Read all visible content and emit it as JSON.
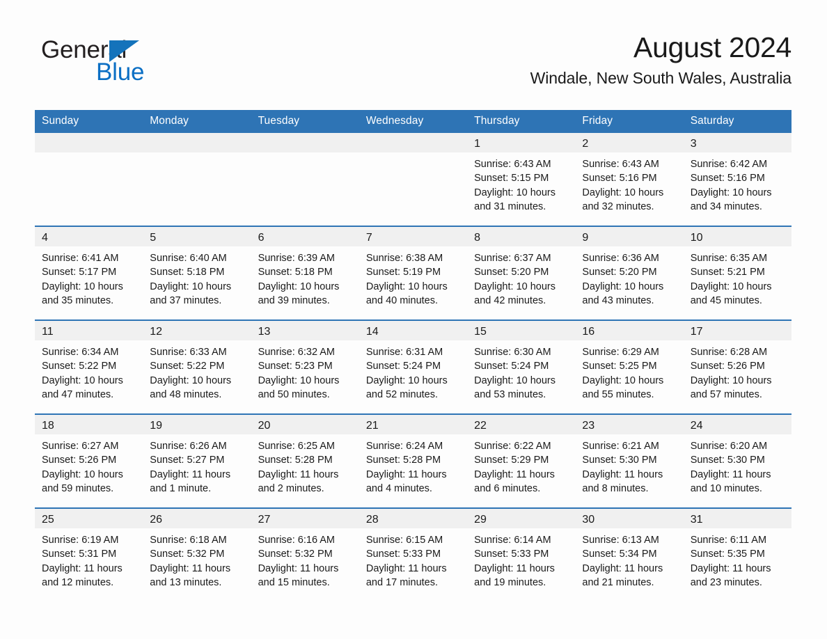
{
  "brand": {
    "name_part1": "General",
    "name_part2": "Blue",
    "accent_color": "#1473bb",
    "blue_text_color": "#0b6fc4",
    "triangle_icon": "triangle-icon"
  },
  "header": {
    "month_title": "August 2024",
    "location": "Windale, New South Wales, Australia"
  },
  "colors": {
    "header_bar": "#2e74b5",
    "daynum_strip": "#f0f0f0",
    "row_separator": "#2e74b5",
    "page_background": "#fdfdfd",
    "text": "#1a1a1a"
  },
  "calendar": {
    "weekday_headers": [
      "Sunday",
      "Monday",
      "Tuesday",
      "Wednesday",
      "Thursday",
      "Friday",
      "Saturday"
    ],
    "labels": {
      "sunrise": "Sunrise:",
      "sunset": "Sunset:",
      "daylight": "Daylight:"
    },
    "weeks": [
      [
        {
          "day": "",
          "lines": []
        },
        {
          "day": "",
          "lines": []
        },
        {
          "day": "",
          "lines": []
        },
        {
          "day": "",
          "lines": []
        },
        {
          "day": "1",
          "lines": [
            "Sunrise: 6:43 AM",
            "Sunset: 5:15 PM",
            "Daylight: 10 hours",
            "and 31 minutes."
          ]
        },
        {
          "day": "2",
          "lines": [
            "Sunrise: 6:43 AM",
            "Sunset: 5:16 PM",
            "Daylight: 10 hours",
            "and 32 minutes."
          ]
        },
        {
          "day": "3",
          "lines": [
            "Sunrise: 6:42 AM",
            "Sunset: 5:16 PM",
            "Daylight: 10 hours",
            "and 34 minutes."
          ]
        }
      ],
      [
        {
          "day": "4",
          "lines": [
            "Sunrise: 6:41 AM",
            "Sunset: 5:17 PM",
            "Daylight: 10 hours",
            "and 35 minutes."
          ]
        },
        {
          "day": "5",
          "lines": [
            "Sunrise: 6:40 AM",
            "Sunset: 5:18 PM",
            "Daylight: 10 hours",
            "and 37 minutes."
          ]
        },
        {
          "day": "6",
          "lines": [
            "Sunrise: 6:39 AM",
            "Sunset: 5:18 PM",
            "Daylight: 10 hours",
            "and 39 minutes."
          ]
        },
        {
          "day": "7",
          "lines": [
            "Sunrise: 6:38 AM",
            "Sunset: 5:19 PM",
            "Daylight: 10 hours",
            "and 40 minutes."
          ]
        },
        {
          "day": "8",
          "lines": [
            "Sunrise: 6:37 AM",
            "Sunset: 5:20 PM",
            "Daylight: 10 hours",
            "and 42 minutes."
          ]
        },
        {
          "day": "9",
          "lines": [
            "Sunrise: 6:36 AM",
            "Sunset: 5:20 PM",
            "Daylight: 10 hours",
            "and 43 minutes."
          ]
        },
        {
          "day": "10",
          "lines": [
            "Sunrise: 6:35 AM",
            "Sunset: 5:21 PM",
            "Daylight: 10 hours",
            "and 45 minutes."
          ]
        }
      ],
      [
        {
          "day": "11",
          "lines": [
            "Sunrise: 6:34 AM",
            "Sunset: 5:22 PM",
            "Daylight: 10 hours",
            "and 47 minutes."
          ]
        },
        {
          "day": "12",
          "lines": [
            "Sunrise: 6:33 AM",
            "Sunset: 5:22 PM",
            "Daylight: 10 hours",
            "and 48 minutes."
          ]
        },
        {
          "day": "13",
          "lines": [
            "Sunrise: 6:32 AM",
            "Sunset: 5:23 PM",
            "Daylight: 10 hours",
            "and 50 minutes."
          ]
        },
        {
          "day": "14",
          "lines": [
            "Sunrise: 6:31 AM",
            "Sunset: 5:24 PM",
            "Daylight: 10 hours",
            "and 52 minutes."
          ]
        },
        {
          "day": "15",
          "lines": [
            "Sunrise: 6:30 AM",
            "Sunset: 5:24 PM",
            "Daylight: 10 hours",
            "and 53 minutes."
          ]
        },
        {
          "day": "16",
          "lines": [
            "Sunrise: 6:29 AM",
            "Sunset: 5:25 PM",
            "Daylight: 10 hours",
            "and 55 minutes."
          ]
        },
        {
          "day": "17",
          "lines": [
            "Sunrise: 6:28 AM",
            "Sunset: 5:26 PM",
            "Daylight: 10 hours",
            "and 57 minutes."
          ]
        }
      ],
      [
        {
          "day": "18",
          "lines": [
            "Sunrise: 6:27 AM",
            "Sunset: 5:26 PM",
            "Daylight: 10 hours",
            "and 59 minutes."
          ]
        },
        {
          "day": "19",
          "lines": [
            "Sunrise: 6:26 AM",
            "Sunset: 5:27 PM",
            "Daylight: 11 hours",
            "and 1 minute."
          ]
        },
        {
          "day": "20",
          "lines": [
            "Sunrise: 6:25 AM",
            "Sunset: 5:28 PM",
            "Daylight: 11 hours",
            "and 2 minutes."
          ]
        },
        {
          "day": "21",
          "lines": [
            "Sunrise: 6:24 AM",
            "Sunset: 5:28 PM",
            "Daylight: 11 hours",
            "and 4 minutes."
          ]
        },
        {
          "day": "22",
          "lines": [
            "Sunrise: 6:22 AM",
            "Sunset: 5:29 PM",
            "Daylight: 11 hours",
            "and 6 minutes."
          ]
        },
        {
          "day": "23",
          "lines": [
            "Sunrise: 6:21 AM",
            "Sunset: 5:30 PM",
            "Daylight: 11 hours",
            "and 8 minutes."
          ]
        },
        {
          "day": "24",
          "lines": [
            "Sunrise: 6:20 AM",
            "Sunset: 5:30 PM",
            "Daylight: 11 hours",
            "and 10 minutes."
          ]
        }
      ],
      [
        {
          "day": "25",
          "lines": [
            "Sunrise: 6:19 AM",
            "Sunset: 5:31 PM",
            "Daylight: 11 hours",
            "and 12 minutes."
          ]
        },
        {
          "day": "26",
          "lines": [
            "Sunrise: 6:18 AM",
            "Sunset: 5:32 PM",
            "Daylight: 11 hours",
            "and 13 minutes."
          ]
        },
        {
          "day": "27",
          "lines": [
            "Sunrise: 6:16 AM",
            "Sunset: 5:32 PM",
            "Daylight: 11 hours",
            "and 15 minutes."
          ]
        },
        {
          "day": "28",
          "lines": [
            "Sunrise: 6:15 AM",
            "Sunset: 5:33 PM",
            "Daylight: 11 hours",
            "and 17 minutes."
          ]
        },
        {
          "day": "29",
          "lines": [
            "Sunrise: 6:14 AM",
            "Sunset: 5:33 PM",
            "Daylight: 11 hours",
            "and 19 minutes."
          ]
        },
        {
          "day": "30",
          "lines": [
            "Sunrise: 6:13 AM",
            "Sunset: 5:34 PM",
            "Daylight: 11 hours",
            "and 21 minutes."
          ]
        },
        {
          "day": "31",
          "lines": [
            "Sunrise: 6:11 AM",
            "Sunset: 5:35 PM",
            "Daylight: 11 hours",
            "and 23 minutes."
          ]
        }
      ]
    ]
  }
}
